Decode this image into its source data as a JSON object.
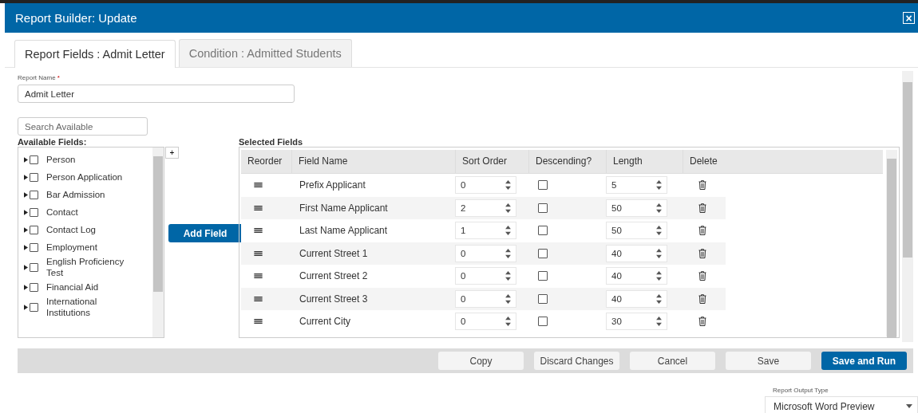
{
  "window": {
    "title": "Report Builder: Update",
    "close_icon": "×"
  },
  "tabs": [
    {
      "label": "Report Fields : Admit Letter",
      "selected": true
    },
    {
      "label": "Condition : Admitted Students",
      "selected": false
    }
  ],
  "report_name": {
    "label": "Report Name",
    "required_mark": "*",
    "value": "Admit Letter"
  },
  "search": {
    "placeholder": "Search Available"
  },
  "available_fields": {
    "label": "Available Fields:",
    "add_button": "+",
    "items": [
      {
        "label": "Person",
        "checked": false
      },
      {
        "label": "Person Application",
        "checked": false
      },
      {
        "label": "Bar Admission",
        "checked": false
      },
      {
        "label": "Contact",
        "checked": false
      },
      {
        "label": "Contact Log",
        "checked": false
      },
      {
        "label": "Employment",
        "checked": false
      },
      {
        "label": "English Proficiency Test",
        "checked": false
      },
      {
        "label": "Financial Aid",
        "checked": false
      },
      {
        "label": "International Institutions",
        "checked": false
      }
    ]
  },
  "add_field_button": "Add Field",
  "selected_fields": {
    "label": "Selected Fields",
    "columns": [
      "Reorder",
      "Field Name",
      "Sort Order",
      "Descending?",
      "Length",
      "Delete"
    ],
    "rows": [
      {
        "field_name": "Prefix Applicant",
        "sort_order": "0",
        "descending": false,
        "length": "5"
      },
      {
        "field_name": "First Name Applicant",
        "sort_order": "2",
        "descending": false,
        "length": "50"
      },
      {
        "field_name": "Last Name Applicant",
        "sort_order": "1",
        "descending": false,
        "length": "50"
      },
      {
        "field_name": "Current Street 1",
        "sort_order": "0",
        "descending": false,
        "length": "40"
      },
      {
        "field_name": "Current Street 2",
        "sort_order": "0",
        "descending": false,
        "length": "40"
      },
      {
        "field_name": "Current Street 3",
        "sort_order": "0",
        "descending": false,
        "length": "40"
      },
      {
        "field_name": "Current City",
        "sort_order": "0",
        "descending": false,
        "length": "30"
      }
    ]
  },
  "footer_buttons": [
    {
      "label": "Copy",
      "kind": "plain"
    },
    {
      "label": "Discard Changes",
      "kind": "plain"
    },
    {
      "label": "Cancel",
      "kind": "plain"
    },
    {
      "label": "Save",
      "kind": "plain"
    },
    {
      "label": "Save and Run",
      "kind": "primary"
    }
  ],
  "output_type": {
    "label": "Report Output Type",
    "value": "Microsoft Word Preview"
  }
}
